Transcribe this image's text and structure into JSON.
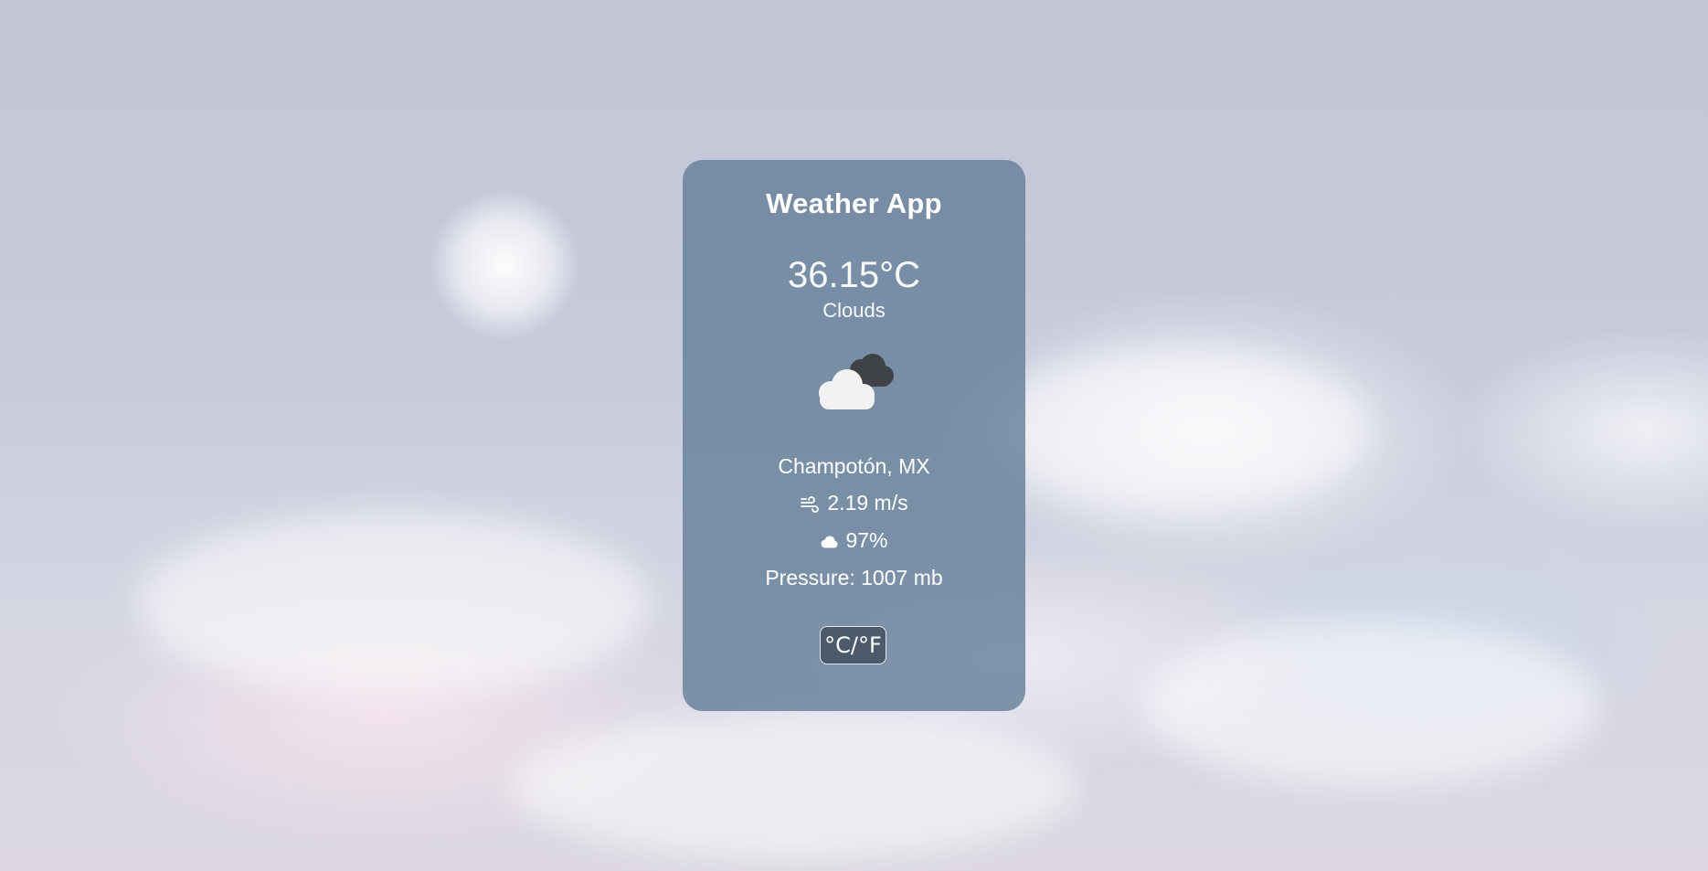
{
  "app": {
    "title": "Weather App"
  },
  "weather": {
    "temperature": "36.15°C",
    "condition": "Clouds",
    "condition_icon": "clouds-icon",
    "location": "Champotón, MX",
    "wind": "2.19 m/s",
    "wind_icon": "wind-icon",
    "humidity": "97%",
    "humidity_icon": "cloud-icon",
    "pressure": "Pressure: 1007 mb"
  },
  "controls": {
    "unit_toggle_label": "°C/°F"
  },
  "colors": {
    "card_background": "#66809a",
    "toggle_background": "#4b5b6b",
    "text": "#ffffff"
  }
}
